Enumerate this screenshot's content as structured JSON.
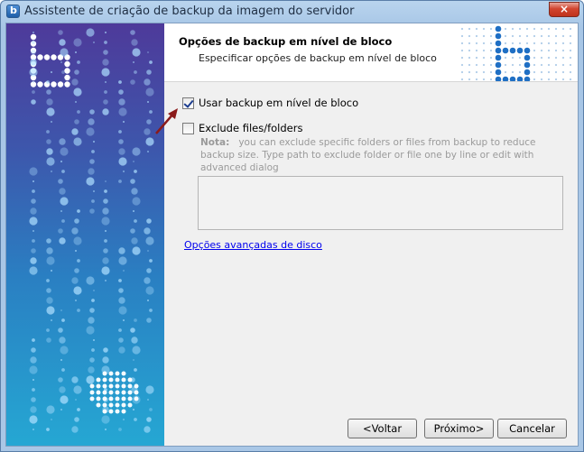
{
  "window": {
    "title": "Assistente de criação de backup da imagem do servidor",
    "close_glyph": "×"
  },
  "header": {
    "title": "Opções de backup em nível de bloco",
    "subtitle": "Especificar opções de backup em nível de bloco"
  },
  "options": {
    "block_backup": {
      "label": "Usar backup em nível de bloco",
      "checked": true
    },
    "exclude_files": {
      "label": "Exclude files/folders",
      "checked": false
    },
    "note_label": "Nota:",
    "note_text": "you can exclude specific folders or files from backup to reduce backup size. Type path to exclude folder or file one by line or edit with advanced dialog",
    "exclude_list_value": ""
  },
  "links": {
    "advanced_disk": "Opções avançadas de disco"
  },
  "buttons": {
    "back": "<Voltar",
    "next": "Próximo>",
    "cancel": "Cancelar"
  },
  "colors": {
    "accent_blue": "#1f6fc4",
    "arrow": "#8b1a1a",
    "link": "#0000ee"
  },
  "icons": [
    "app-icon",
    "close-icon",
    "arrow-pointer-icon",
    "brand-logo-icon"
  ]
}
